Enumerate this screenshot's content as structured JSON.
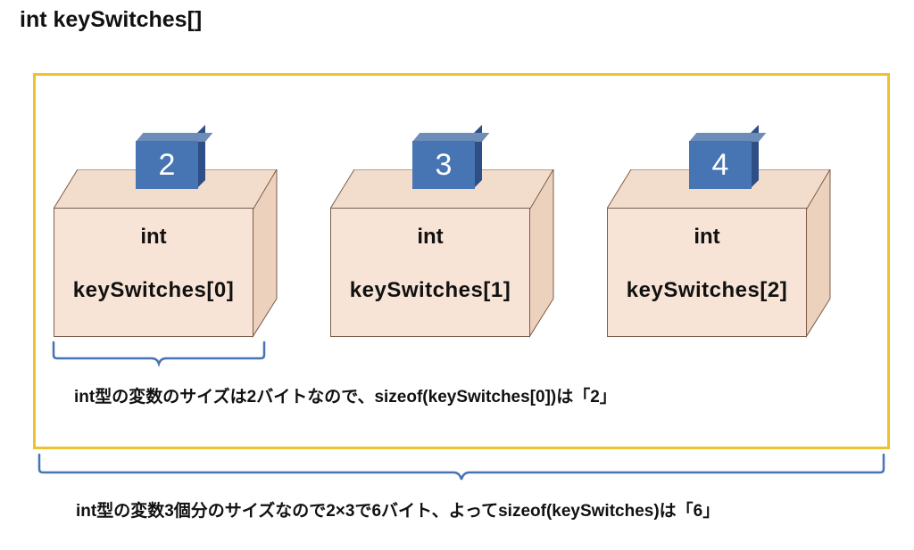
{
  "title": "int keySwitches[]",
  "boxes": [
    {
      "value": "2",
      "type": "int",
      "name": "keySwitches[0]"
    },
    {
      "value": "3",
      "type": "int",
      "name": "keySwitches[1]"
    },
    {
      "value": "4",
      "type": "int",
      "name": "keySwitches[2]"
    }
  ],
  "caption_one": "int型の変数のサイズは2バイトなので、sizeof(keySwitches[0])は「2」",
  "caption_two": "int型の変数3個分のサイズなので2×3で6バイト、よってsizeof(keySwitches)は「6」",
  "colors": {
    "frame": "#edc22d",
    "box_fill": "#f8e4d6",
    "box_stroke": "#7b5d4a",
    "chip": "#4774b3",
    "bracket": "#4774b3"
  }
}
